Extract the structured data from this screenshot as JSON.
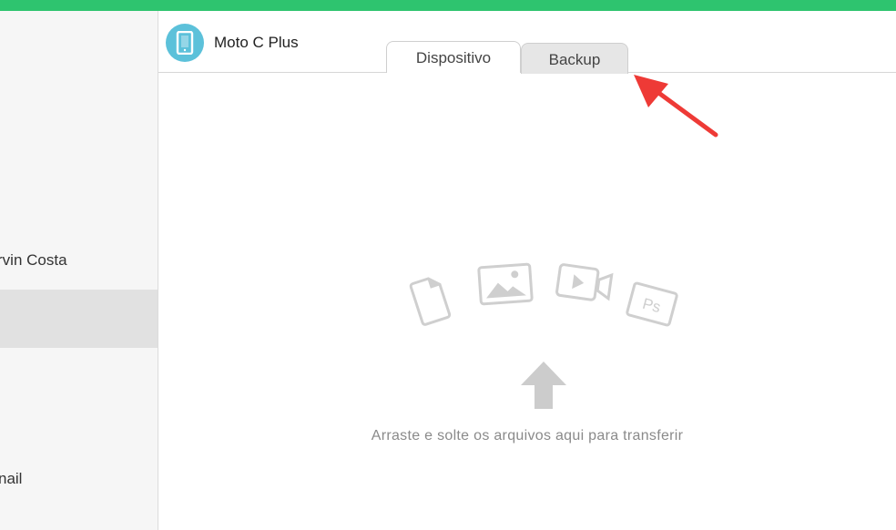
{
  "colors": {
    "accent": "#2ec46f",
    "device_icon": "#5cc1da",
    "annotation_arrow": "#ee3a36"
  },
  "sidebar": {
    "items": [
      {
        "label": "rvin Costa",
        "selected": false
      },
      {
        "label": "",
        "selected": true
      },
      {
        "label": "nail",
        "selected": false
      }
    ]
  },
  "device": {
    "name": "Moto C Plus",
    "icon": "tablet-icon"
  },
  "tabs": [
    {
      "label": "Dispositivo",
      "active": true
    },
    {
      "label": "Backup",
      "active": false
    }
  ],
  "drop_zone": {
    "text": "Arraste e solte os arquivos aqui para transferir",
    "icons": [
      "document-icon",
      "image-icon",
      "video-icon",
      "photoshop-icon",
      "upload-arrow-icon"
    ],
    "ps_label": "Ps"
  }
}
